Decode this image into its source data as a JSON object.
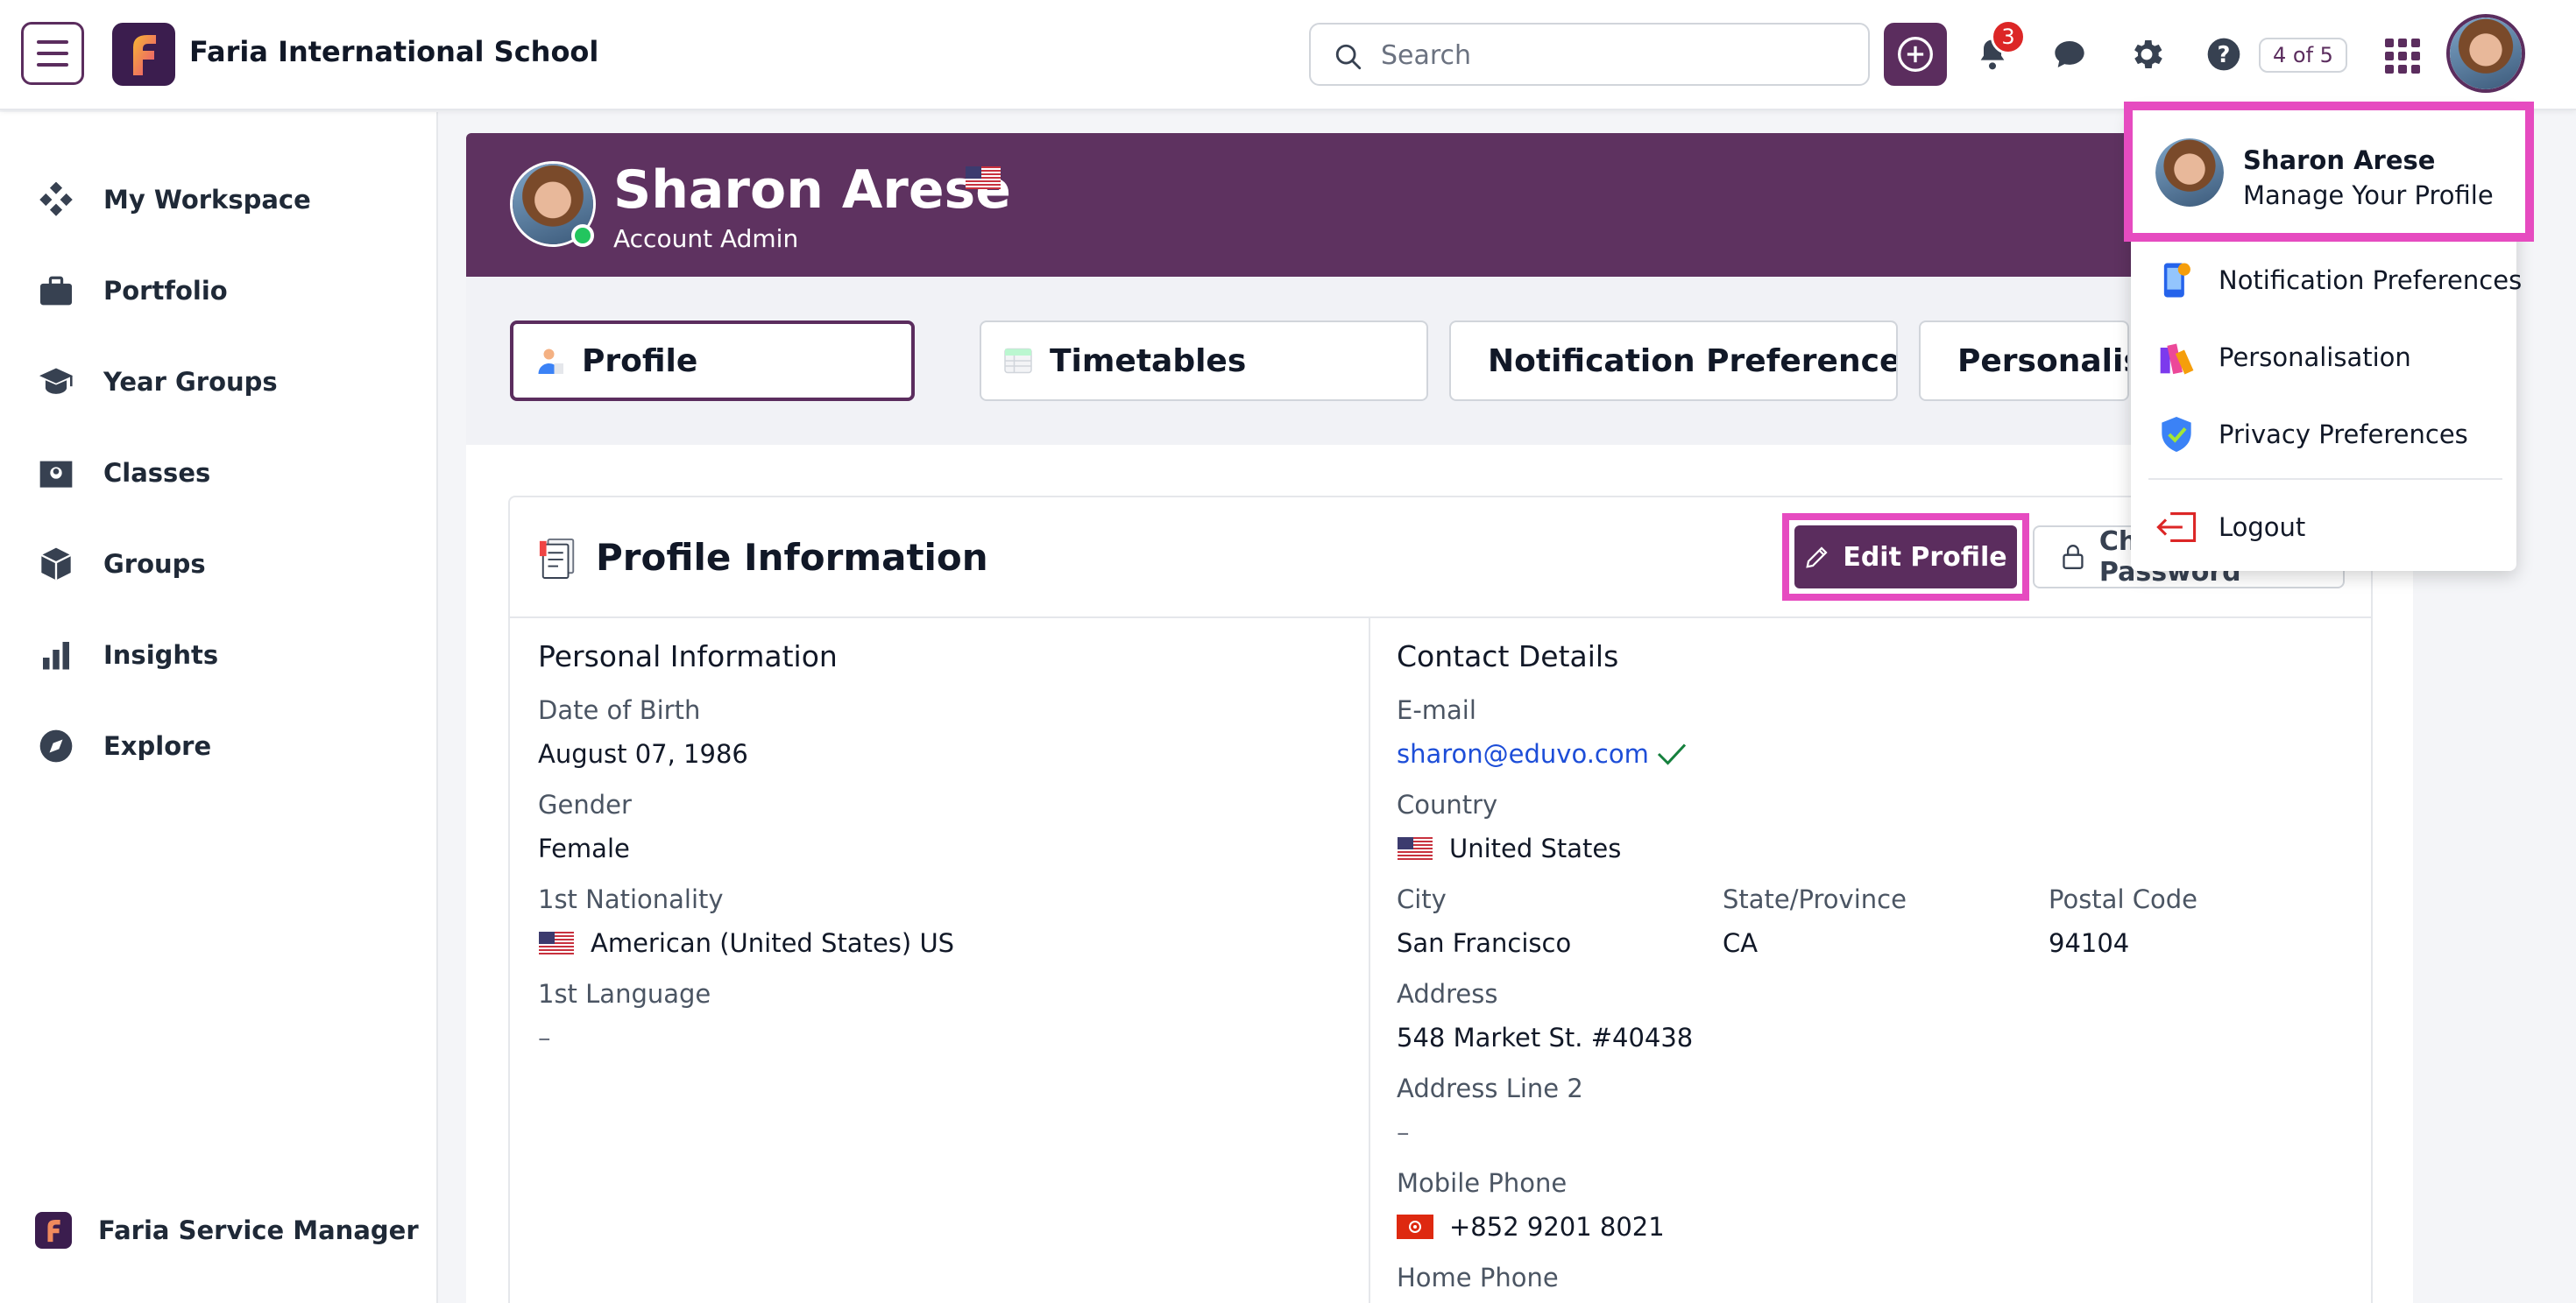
{
  "header": {
    "org_name": "Faria International School",
    "search_placeholder": "Search",
    "notification_count": "3",
    "steps": "4 of 5"
  },
  "sidebar": {
    "items": [
      {
        "label": "My Workspace",
        "icon": "workspace-icon"
      },
      {
        "label": "Portfolio",
        "icon": "briefcase-icon"
      },
      {
        "label": "Year Groups",
        "icon": "graduation-cap-icon"
      },
      {
        "label": "Classes",
        "icon": "classes-icon"
      },
      {
        "label": "Groups",
        "icon": "cube-icon"
      },
      {
        "label": "Insights",
        "icon": "bar-chart-icon"
      },
      {
        "label": "Explore",
        "icon": "compass-icon"
      }
    ],
    "footer_label": "Faria Service Manager"
  },
  "profile": {
    "name": "Sharon Arese",
    "role": "Account Admin"
  },
  "tabs": [
    {
      "label": "Profile",
      "active": true
    },
    {
      "label": "Timetables",
      "active": false
    },
    {
      "label": "Notification Preferences",
      "active": false
    },
    {
      "label": "Personalisation",
      "active": false
    }
  ],
  "card": {
    "title": "Profile Information",
    "edit_label": "Edit Profile",
    "change_label": "Change Password"
  },
  "personal": {
    "title": "Personal Information",
    "dob_label": "Date of Birth",
    "dob": "August 07, 1986",
    "gender_label": "Gender",
    "gender": "Female",
    "nationality_label": "1st Nationality",
    "nationality": "American (United States) US",
    "language_label": "1st Language",
    "language": "–"
  },
  "contact": {
    "title": "Contact Details",
    "email_label": "E-mail",
    "email": "sharon@eduvo.com",
    "country_label": "Country",
    "country": "United States",
    "city_label": "City",
    "city": "San Francisco",
    "state_label": "State/Province",
    "state": "CA",
    "postal_label": "Postal Code",
    "postal": "94104",
    "address_label": "Address",
    "address": "548 Market St. #40438",
    "address2_label": "Address Line 2",
    "address2": "–",
    "mobile_label": "Mobile Phone",
    "mobile": "+852 9201 8021",
    "home_label": "Home Phone"
  },
  "dropdown": {
    "name": "Sharon Arese",
    "manage": "Manage Your Profile",
    "items": [
      {
        "label": "Notification Preferences",
        "icon": "notification-phone-icon"
      },
      {
        "label": "Personalisation",
        "icon": "palette-icon"
      },
      {
        "label": "Privacy Preferences",
        "icon": "shield-check-icon"
      }
    ],
    "logout": "Logout"
  },
  "colors": {
    "brand": "#5b2d5e",
    "banner": "#5e3260",
    "highlight": "#e64bc0",
    "link": "#1d4ed8"
  }
}
